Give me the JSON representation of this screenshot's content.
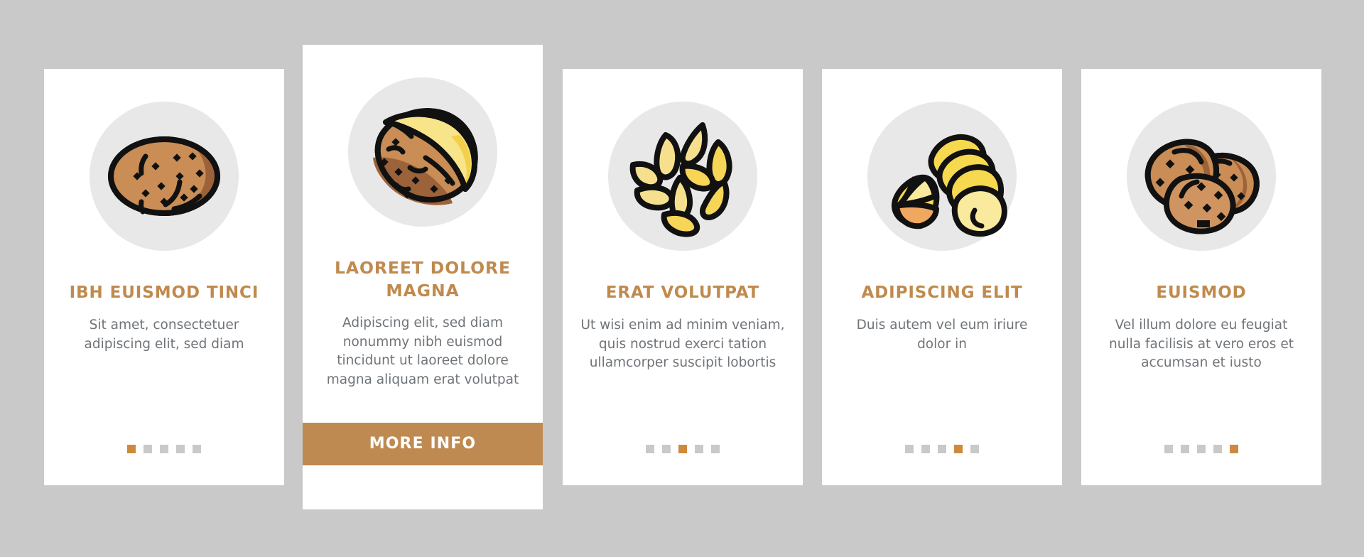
{
  "page": {
    "background_color": "#c9c9c9",
    "accent_color": "#c08a4e",
    "button_color": "#bf8a51",
    "dot_active_color": "#cd8a3c",
    "dot_inactive_color": "#c9c9c9",
    "body_text_color": "#6f7479",
    "icon_circle_color": "#e8e8e8"
  },
  "cards": [
    {
      "id": "card-1",
      "icon_name": "whole-potato-icon",
      "title": "IBH EUISMOD TINCI",
      "body": "Sit amet, consectetuer adipiscing elit, sed diam",
      "dots": {
        "count": 5,
        "active_index": 0
      },
      "featured": false
    },
    {
      "id": "card-2",
      "icon_name": "halved-potato-icon",
      "title": "LAOREET DOLORE MAGNA",
      "body": "Adipiscing elit, sed diam nonummy nibh euismod tincidunt ut laoreet dolore magna aliquam erat volutpat",
      "button_label": "MORE INFO",
      "featured": true
    },
    {
      "id": "card-3",
      "icon_name": "potato-seeds-icon",
      "title": "ERAT VOLUTPAT",
      "body": "Ut wisi enim ad minim veniam, quis nostrud exerci tation ullamcorper suscipit lobortis",
      "dots": {
        "count": 5,
        "active_index": 2
      },
      "featured": false
    },
    {
      "id": "card-4",
      "icon_name": "sliced-potato-icon",
      "title": "ADIPISCING ELIT",
      "body": "Duis autem vel eum iriure dolor in",
      "dots": {
        "count": 5,
        "active_index": 3
      },
      "featured": false
    },
    {
      "id": "card-5",
      "icon_name": "potato-pile-icon",
      "title": "EUISMOD",
      "body": "Vel illum dolore eu feugiat nulla facilisis at vero eros et accumsan et iusto",
      "dots": {
        "count": 5,
        "active_index": 4
      },
      "featured": false
    }
  ]
}
